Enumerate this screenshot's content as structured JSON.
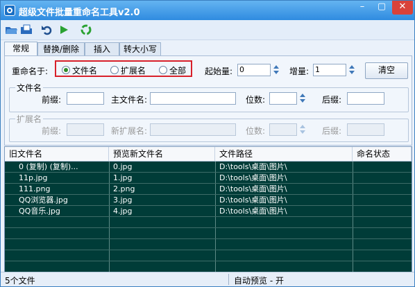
{
  "title": "超级文件批量重命名工具v2.0",
  "window_controls": {
    "minimize": "–",
    "maximize": "▢",
    "close": "✕"
  },
  "toolbar": {
    "icons": [
      "open-folder-icon",
      "open-file-icon",
      "undo-icon",
      "run-icon",
      "recycle-icon"
    ]
  },
  "tabs": [
    "常规",
    "替换/删除",
    "插入",
    "转大小写"
  ],
  "active_tab": 0,
  "rename_to": {
    "label": "重命名于:",
    "options": [
      "文件名",
      "扩展名",
      "全部"
    ],
    "selected": 0
  },
  "start": {
    "label": "起始量:",
    "value": "0"
  },
  "increment": {
    "label": "增量:",
    "value": "1"
  },
  "clear_button": "清空",
  "filename_group": {
    "title": "文件名",
    "prefix_label": "前缀:",
    "mainname_label": "主文件名:",
    "digits_label": "位数:",
    "suffix_label": "后缀:"
  },
  "ext_group": {
    "title": "扩展名",
    "prefix_label": "前缀:",
    "newext_label": "新扩展名:",
    "digits_label": "位数:",
    "suffix_label": "后缀:"
  },
  "table": {
    "headers": [
      "旧文件名",
      "预览新文件名",
      "文件路径",
      "命名状态"
    ],
    "rows": [
      [
        "0 (复制) (复制)...",
        "0.jpg",
        "D:\\tools\\桌面\\图片\\",
        ""
      ],
      [
        "11p.jpg",
        "1.jpg",
        "D:\\tools\\桌面\\图片\\",
        ""
      ],
      [
        "111.png",
        "2.png",
        "D:\\tools\\桌面\\图片\\",
        ""
      ],
      [
        "QQ浏览器.jpg",
        "3.jpg",
        "D:\\tools\\桌面\\图片\\",
        ""
      ],
      [
        "QQ音乐.jpg",
        "4.jpg",
        "D:\\tools\\桌面\\图片\\",
        ""
      ]
    ]
  },
  "status": {
    "left": "5个文件",
    "right": "自动预览 - 开"
  },
  "colors": {
    "title_bar": "#2f8be0",
    "table_bg": "#003c38",
    "highlight": "#d8202a"
  }
}
